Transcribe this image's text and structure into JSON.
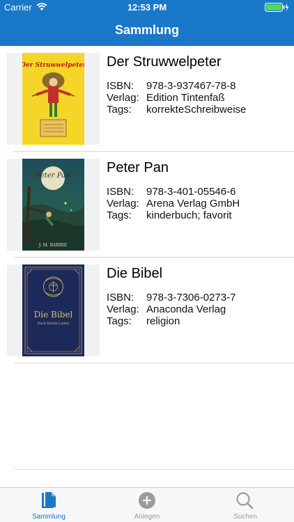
{
  "status_bar": {
    "carrier": "Carrier",
    "time": "12:53 PM"
  },
  "nav": {
    "title": "Sammlung"
  },
  "colors": {
    "accent": "#1a78c8",
    "inactive": "#9b9b9b"
  },
  "books": [
    {
      "title": "Der Struwwelpeter",
      "isbn_label": "ISBN:",
      "isbn": "978-3-937467-78-8",
      "publisher_label": "Verlag:",
      "publisher": "Edition Tintenfaß",
      "tags_label": "Tags:",
      "tags": "korrekteSchreibweise",
      "cover_lettering": "Der Struwwelpeter"
    },
    {
      "title": "Peter Pan",
      "isbn_label": "ISBN:",
      "isbn": "978-3-401-05546-6",
      "publisher_label": "Verlag:",
      "publisher": "Arena Verlag GmbH",
      "tags_label": "Tags:",
      "tags": "kinderbuch; favorit",
      "cover_lettering": "Peter Pan",
      "cover_author": "J. M. BARRIE"
    },
    {
      "title": "Die Bibel",
      "isbn_label": "ISBN:",
      "isbn": "978-3-7306-0273-7",
      "publisher_label": "Verlag:",
      "publisher": "Anaconda Verlag",
      "tags_label": "Tags:",
      "tags": "religion",
      "cover_lettering": "Die Bibel",
      "cover_subtitle": "Nach Martin Luther"
    }
  ],
  "tabs": [
    {
      "label": "Sammlung",
      "icon": "documents-icon",
      "active": true
    },
    {
      "label": "Anlegen",
      "icon": "add-circle-icon",
      "active": false
    },
    {
      "label": "Suchen",
      "icon": "search-icon",
      "active": false
    }
  ]
}
